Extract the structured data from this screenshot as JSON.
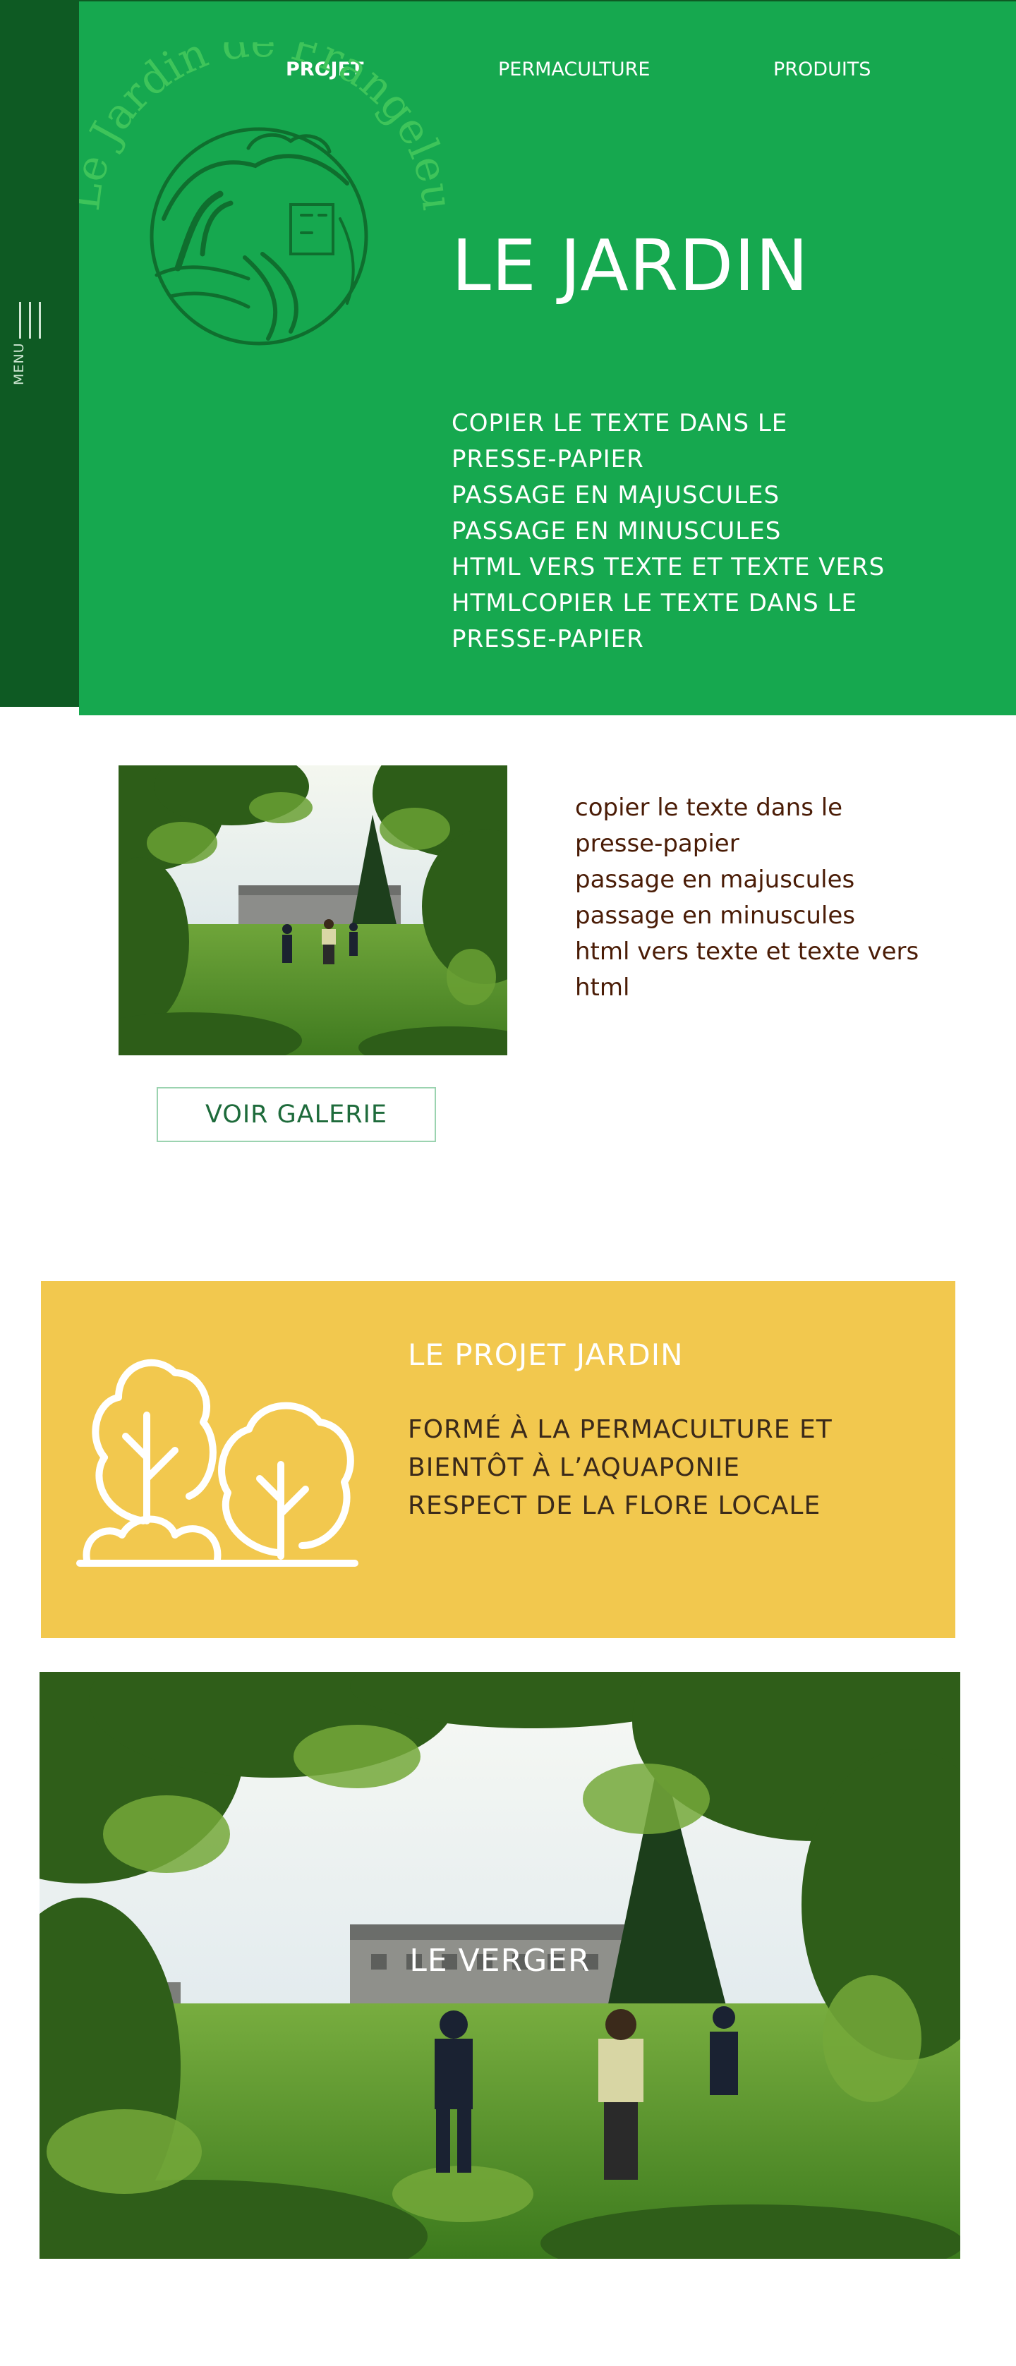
{
  "sidebar": {
    "menu_label": "MENU"
  },
  "nav": {
    "items": [
      "PROJET",
      "PERMACULTURE",
      "PRODUITS"
    ]
  },
  "logo": {
    "text": "Le Jardin de Frangeleu"
  },
  "hero": {
    "title": "LE JARDIN",
    "lines": [
      "COPIER LE TEXTE DANS LE",
      "PRESSE-PAPIER",
      "PASSAGE EN MAJUSCULES",
      "PASSAGE EN MINUSCULES",
      "HTML VERS TEXTE ET TEXTE VERS",
      "HTMLCOPIER LE TEXTE DANS LE",
      "PRESSE-PAPIER"
    ]
  },
  "section2": {
    "lines": [
      "copier le texte dans le",
      "presse-papier",
      "passage en majuscules",
      "passage en minuscules",
      "html vers texte et texte vers",
      "html"
    ],
    "gallery_button": "VOIR  GALERIE"
  },
  "card": {
    "title": "LE PROJET JARDIN",
    "lines": [
      "FORMÉ À LA PERMACULTURE ET",
      "BIENTÔT À L’AQUAPONIE",
      "RESPECT DE LA FLORE LOCALE"
    ]
  },
  "verger": {
    "label": "LE VERGER"
  },
  "colors": {
    "hero_green": "#16a84f",
    "sidebar_green": "#0e5a23",
    "card_yellow": "#f2c84e",
    "body_text_brown": "#4a1c06"
  }
}
